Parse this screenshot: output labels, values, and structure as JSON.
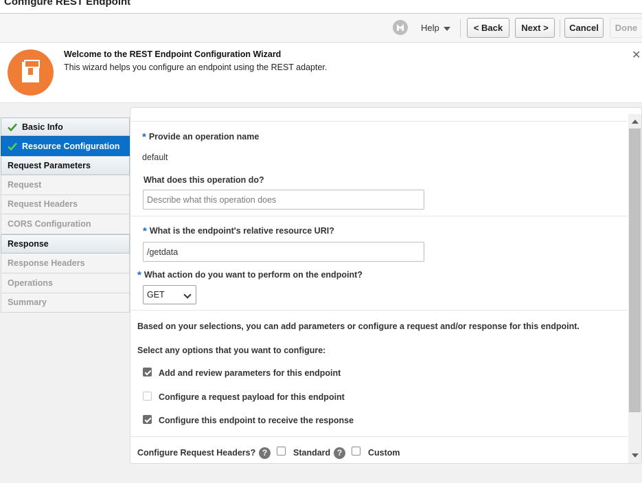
{
  "window": {
    "title": "Configure REST Endpoint"
  },
  "toolbar": {
    "logo_icon": "oracle-integration-icon",
    "help_label": "Help",
    "back_label": "< Back",
    "next_label": "Next >",
    "cancel_label": "Cancel",
    "done_label": "Done"
  },
  "banner": {
    "icon": "wizard-icon",
    "title": "Welcome to the REST Endpoint Configuration Wizard",
    "subtitle": "This wizard helps you configure an endpoint using the REST adapter.",
    "close_icon": "close-icon"
  },
  "nav": {
    "items": [
      {
        "label": "Basic Info",
        "state": "completed"
      },
      {
        "label": "Resource Configuration",
        "state": "active"
      },
      {
        "label": "Request Parameters",
        "state": "enabled"
      },
      {
        "label": "Request",
        "state": "disabled"
      },
      {
        "label": "Request Headers",
        "state": "disabled"
      },
      {
        "label": "CORS Configuration",
        "state": "disabled"
      },
      {
        "label": "Response",
        "state": "enabled"
      },
      {
        "label": "Response Headers",
        "state": "disabled"
      },
      {
        "label": "Operations",
        "state": "disabled"
      },
      {
        "label": "Summary",
        "state": "disabled"
      }
    ]
  },
  "form": {
    "operation_name_label": "Provide an operation name",
    "operation_name_value": "default",
    "operation_desc_label": "What does this operation do?",
    "operation_desc_placeholder": "Describe what this operation does",
    "uri_label": "What is the endpoint's relative resource URI?",
    "uri_value": "/getdata",
    "action_label": "What action do you want to perform on the endpoint?",
    "action_value": "GET",
    "selection_note": "Based on your selections, you can add parameters or configure a request and/or response for this endpoint.",
    "options_prompt": "Select any options that you want to configure:",
    "options": [
      {
        "label": "Add and review parameters for this endpoint",
        "checked": true
      },
      {
        "label": "Configure a request payload for this endpoint",
        "checked": false
      },
      {
        "label": "Configure this endpoint to receive the response",
        "checked": true
      }
    ],
    "headers_label": "Configure Request Headers?",
    "headers_standard_label": "Standard",
    "headers_custom_label": "Custom",
    "headers_standard_checked": false,
    "headers_custom_checked": false
  },
  "colors": {
    "accent": "#0a70c9",
    "banner_icon": "#ef7d35",
    "required_asterisk": "#1a6fbf"
  }
}
